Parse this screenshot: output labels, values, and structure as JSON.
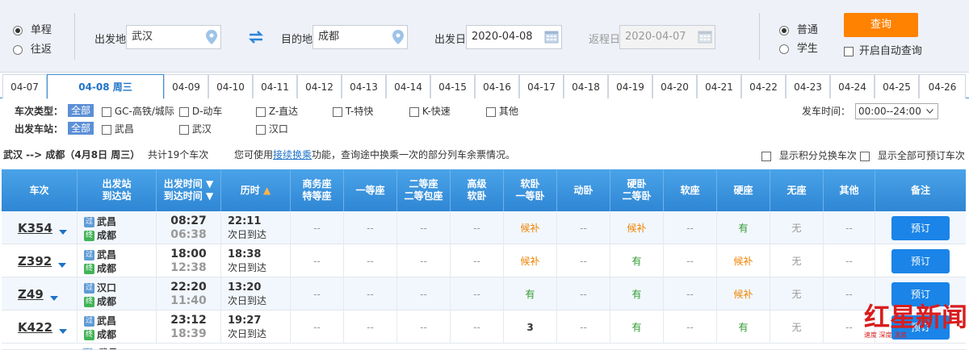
{
  "trip_type": {
    "oneway": "单程",
    "roundtrip": "往返"
  },
  "from": {
    "label": "出发地",
    "value": "武汉"
  },
  "swap_icon": "swap-arrows-icon",
  "to": {
    "label": "目的地",
    "value": "成都"
  },
  "depart_date": {
    "label": "出发日",
    "value": "2020-04-08"
  },
  "return_date": {
    "label": "返程日",
    "value": "2020-04-07"
  },
  "passenger": {
    "normal": "普通",
    "student": "学生"
  },
  "query_button": "查询",
  "auto_query": "开启自动查询",
  "date_tabs": [
    "04-07",
    "04-08 周三",
    "04-09",
    "04-10",
    "04-11",
    "04-12",
    "04-13",
    "04-14",
    "04-15",
    "04-16",
    "04-17",
    "04-18",
    "04-19",
    "04-20",
    "04-21",
    "04-22",
    "04-23",
    "04-24",
    "04-25",
    "04-26"
  ],
  "filters": {
    "type_label": "车次类型：",
    "station_label": "出发车站：",
    "all": "全部",
    "types": [
      "GC-高铁/城际",
      "D-动车",
      "Z-直达",
      "T-特快",
      "K-快速",
      "其他"
    ],
    "stations": [
      "武昌",
      "武汉",
      "汉口"
    ],
    "time_label": "发车时间：",
    "time_value": "00:00--24:00"
  },
  "summary": {
    "route": "武汉 --> 成都（4月8日  周三）",
    "count": "共计19个车次",
    "tip_pre": "您可使用",
    "tip_link": "接续换乘",
    "tip_post": "功能，查询途中换乘一次的部分列车余票情况。",
    "opt1": "显示积分兑换车次",
    "opt2": "显示全部可预订车次"
  },
  "headers": {
    "train": "车次",
    "station1": "出发站",
    "station2": "到达站",
    "time1": "出发时间",
    "time2": "到达时间",
    "duration": "历时",
    "biz1": "商务座",
    "biz2": "特等座",
    "first": "一等座",
    "second1": "二等座",
    "second2": "二等包座",
    "hisoft1": "高级",
    "hisoft2": "软卧",
    "soft1": "软卧",
    "soft2": "一等卧",
    "move": "动卧",
    "hard1": "硬卧",
    "hard2": "二等卧",
    "softseat": "软座",
    "hardseat": "硬座",
    "noseat": "无座",
    "other": "其他",
    "note": "备注"
  },
  "rows": [
    {
      "code": "K354",
      "from_badge": "过",
      "from": "武昌",
      "to_badge": "终",
      "to": "成都",
      "dep": "08:27",
      "arr": "06:38",
      "dur": "22:11",
      "dur2": "次日到达",
      "seats": [
        "--",
        "--",
        "--",
        "--",
        "候补",
        "--",
        "候补",
        "--",
        "有",
        "无",
        "--"
      ],
      "book": "预订"
    },
    {
      "code": "Z392",
      "from_badge": "过",
      "from": "武昌",
      "to_badge": "终",
      "to": "成都",
      "dep": "18:00",
      "arr": "12:38",
      "dur": "18:38",
      "dur2": "次日到达",
      "seats": [
        "--",
        "--",
        "--",
        "--",
        "候补",
        "--",
        "有",
        "--",
        "候补",
        "无",
        "--"
      ],
      "book": "预订"
    },
    {
      "code": "Z49",
      "from_badge": "过",
      "from": "汉口",
      "to_badge": "终",
      "to": "成都",
      "dep": "22:20",
      "arr": "11:40",
      "dur": "13:20",
      "dur2": "次日到达",
      "seats": [
        "--",
        "--",
        "--",
        "--",
        "有",
        "--",
        "有",
        "--",
        "候补",
        "无",
        "--"
      ],
      "book": "预订"
    },
    {
      "code": "K422",
      "from_badge": "过",
      "from": "武昌",
      "to_badge": "终",
      "to": "成都",
      "dep": "23:12",
      "arr": "18:39",
      "dur": "19:27",
      "dur2": "次日到达",
      "seats": [
        "--",
        "--",
        "--",
        "--",
        "3",
        "--",
        "有",
        "--",
        "有",
        "无",
        "--"
      ],
      "book": "预订"
    }
  ],
  "next_row_from": "武昌",
  "watermark": "红星新闻"
}
